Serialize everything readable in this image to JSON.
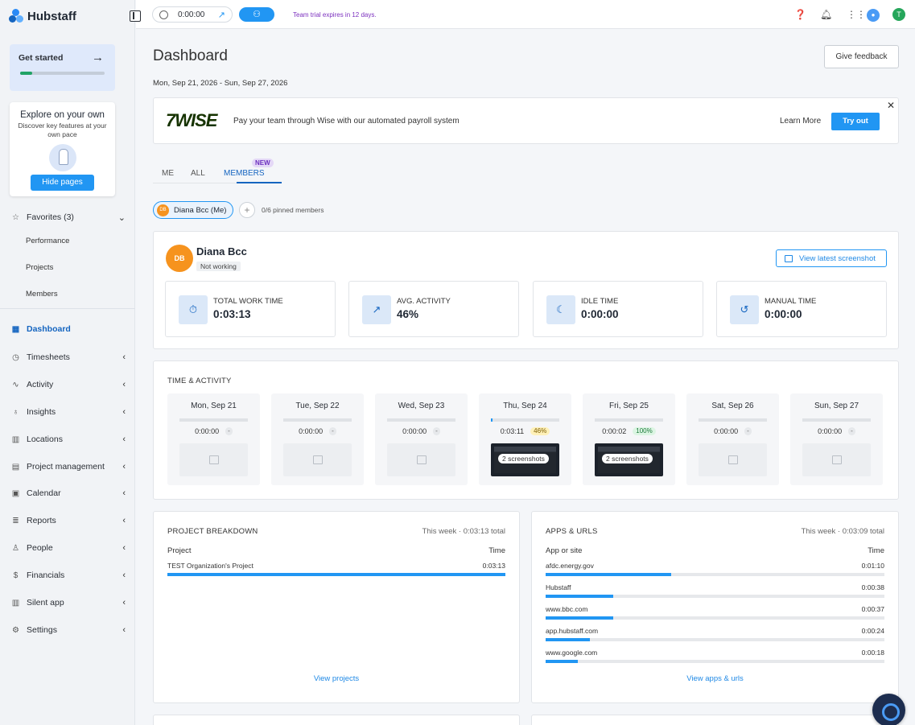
{
  "brand": {
    "name": "Hubstaff"
  },
  "sidebar": {
    "get_started": "Get started",
    "get_started_progress": 0.14,
    "explore_title": "Explore on your own",
    "explore_sub": "Discover key features at your own pace",
    "hide_pages": "Hide pages",
    "favorites": "Favorites (3)",
    "sub_items": [
      "Performance",
      "Projects",
      "Members"
    ],
    "items": [
      {
        "label": "Dashboard",
        "icon": "grid-icon"
      },
      {
        "label": "Timesheets",
        "icon": "clock-icon"
      },
      {
        "label": "Activity",
        "icon": "activity-icon"
      },
      {
        "label": "Insights",
        "icon": "bulb-icon"
      },
      {
        "label": "Locations",
        "icon": "map-icon"
      },
      {
        "label": "Project management",
        "icon": "clipboard-icon"
      },
      {
        "label": "Calendar",
        "icon": "calendar-icon"
      },
      {
        "label": "Reports",
        "icon": "report-icon"
      },
      {
        "label": "People",
        "icon": "person-icon"
      },
      {
        "label": "Financials",
        "icon": "dollar-icon"
      },
      {
        "label": "Silent app",
        "icon": "building-icon"
      },
      {
        "label": "Settings",
        "icon": "gear-icon"
      }
    ]
  },
  "topbar": {
    "timer": "0:00:00",
    "trial": "Team trial expires in 12 days.",
    "avatar": "T"
  },
  "main": {
    "title": "Dashboard",
    "date_range": "Mon, Sep 21, 2026 - Sun, Sep 27, 2026",
    "feedback": "Give feedback",
    "promo": {
      "logo": "7WISE",
      "text": "Pay your team through Wise with our automated payroll system",
      "learn": "Learn More",
      "try": "Try out"
    },
    "tabs": [
      "ME",
      "ALL",
      "MEMBERS"
    ],
    "new_badge": "NEW",
    "member_chip": "Diana Bcc (Me)",
    "chip_initials": "DB",
    "pinned": "0/6 pinned members",
    "member": {
      "initials": "DB",
      "name": "Diana Bcc",
      "status": "Not working",
      "view_shot": "View latest screenshot"
    },
    "stats": [
      {
        "label": "TOTAL WORK TIME",
        "value": "0:03:13",
        "icon": "stopwatch-icon"
      },
      {
        "label": "AVG. ACTIVITY",
        "value": "46%",
        "icon": "trend-icon"
      },
      {
        "label": "IDLE TIME",
        "value": "0:00:00",
        "icon": "moon-icon"
      },
      {
        "label": "MANUAL TIME",
        "value": "0:00:00",
        "icon": "history-icon"
      }
    ],
    "time_activity": {
      "title": "TIME & ACTIVITY",
      "days": [
        {
          "name": "Mon, Sep 21",
          "time": "0:00:00",
          "pct": "-",
          "bar": 0,
          "shots": ""
        },
        {
          "name": "Tue, Sep 22",
          "time": "0:00:00",
          "pct": "-",
          "bar": 0,
          "shots": ""
        },
        {
          "name": "Wed, Sep 23",
          "time": "0:00:00",
          "pct": "-",
          "bar": 0,
          "shots": ""
        },
        {
          "name": "Thu, Sep 24",
          "time": "0:03:11",
          "pct": "46%",
          "bar": 0.02,
          "shots": "2 screenshots"
        },
        {
          "name": "Fri, Sep 25",
          "time": "0:00:02",
          "pct": "100%",
          "bar": 0,
          "shots": "2 screenshots"
        },
        {
          "name": "Sat, Sep 26",
          "time": "0:00:00",
          "pct": "-",
          "bar": 0,
          "shots": ""
        },
        {
          "name": "Sun, Sep 27",
          "time": "0:00:00",
          "pct": "-",
          "bar": 0,
          "shots": ""
        }
      ]
    },
    "project_breakdown": {
      "title": "PROJECT BREAKDOWN",
      "sub": "This week · 0:03:13 total",
      "col1": "Project",
      "col2": "Time",
      "rows": [
        {
          "name": "TEST Organization's Project",
          "time": "0:03:13",
          "share": 1.0
        }
      ],
      "link": "View projects"
    },
    "apps_urls": {
      "title": "APPS & URLS",
      "sub": "This week · 0:03:09 total",
      "col1": "App or site",
      "col2": "Time",
      "rows": [
        {
          "name": "afdc.energy.gov",
          "time": "0:01:10",
          "share": 0.37
        },
        {
          "name": "Hubstaff",
          "time": "0:00:38",
          "share": 0.2
        },
        {
          "name": "www.bbc.com",
          "time": "0:00:37",
          "share": 0.2
        },
        {
          "name": "app.hubstaff.com",
          "time": "0:00:24",
          "share": 0.13
        },
        {
          "name": "www.google.com",
          "time": "0:00:18",
          "share": 0.095
        }
      ],
      "link": "View apps & urls"
    }
  }
}
